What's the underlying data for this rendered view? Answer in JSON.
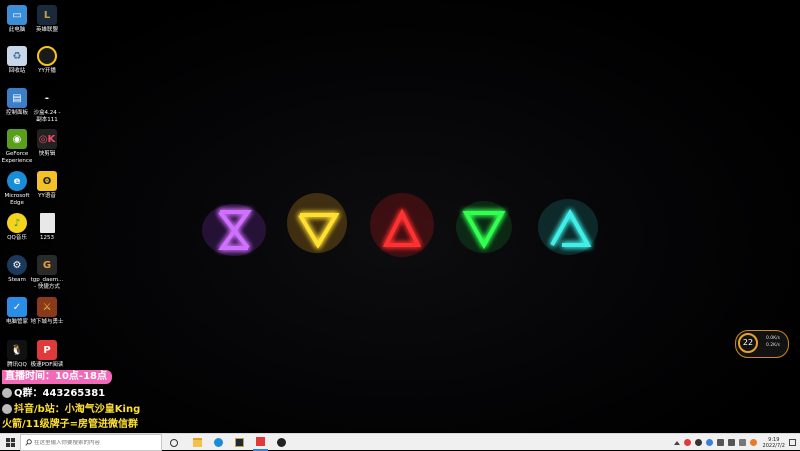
{
  "desktop": {
    "icons": [
      {
        "label": "此电脑",
        "icon": "computer-icon",
        "color": "#3a8fd8"
      },
      {
        "label": "英雄联盟",
        "icon": "lol-icon",
        "color": "#1b2a3a"
      },
      {
        "label": "回收站",
        "icon": "recycle-bin-icon",
        "color": "#c8d8e8"
      },
      {
        "label": "YY开播",
        "icon": "yy-live-icon",
        "color": "#f7c51e"
      },
      {
        "label": "控制面板",
        "icon": "control-panel-icon",
        "color": "#3a7fc8"
      },
      {
        "label": "沙盒4.24 - 副本111",
        "icon": "shortcut-icon",
        "color": "#000000"
      },
      {
        "label": "GeForce Experience",
        "icon": "geforce-icon",
        "color": "#5a9e1e"
      },
      {
        "label": "快剪辑",
        "icon": "kuaijianji-icon",
        "color": "#222222"
      },
      {
        "label": "Microsoft Edge",
        "icon": "edge-icon",
        "color": "#1a8dd8"
      },
      {
        "label": "YY语音",
        "icon": "yy-voice-icon",
        "color": "#f4c128"
      },
      {
        "label": "QQ音乐",
        "icon": "qq-music-icon",
        "color": "#f5d21e"
      },
      {
        "label": "1253",
        "icon": "file-icon",
        "color": "#e8e8e8"
      },
      {
        "label": "Steam",
        "icon": "steam-icon",
        "color": "#1b3a5a"
      },
      {
        "label": "tgp_daem... - 快捷方式",
        "icon": "tgp-icon",
        "color": "#2a2a2a"
      },
      {
        "label": "电脑管家",
        "icon": "pc-manager-icon",
        "color": "#2a8de8"
      },
      {
        "label": "地下城与勇士",
        "icon": "dnf-icon",
        "color": "#8a3a1a"
      },
      {
        "label": "腾讯QQ",
        "icon": "qq-icon",
        "color": "#111111"
      },
      {
        "label": "极速PDF阅读",
        "icon": "pdf-reader-icon",
        "color": "#e03a3a"
      }
    ]
  },
  "overlay": {
    "line1": "直播时间：10点-18点",
    "line2": "Q群：443265381",
    "line3": "抖音/b站：小淘气沙皇King",
    "line4": "火箭/11级牌子=房管进微信群"
  },
  "widget": {
    "temp": "22",
    "up": "0.0K/s",
    "down": "0.2K/s"
  },
  "taskbar": {
    "search_placeholder": "在这里输入你要搜索的内容",
    "apps": [
      "task-view-icon",
      "file-explorer-icon",
      "edge-icon",
      "lol-icon",
      "pdf-reader-icon",
      "obs-icon"
    ],
    "time": "9:19",
    "date": "2022/7/2"
  },
  "colors": {
    "purple": "#b040ff",
    "yellow": "#ffd21e",
    "red": "#ff2a2a",
    "green": "#2aff4a",
    "cyan": "#3ae8e0"
  }
}
